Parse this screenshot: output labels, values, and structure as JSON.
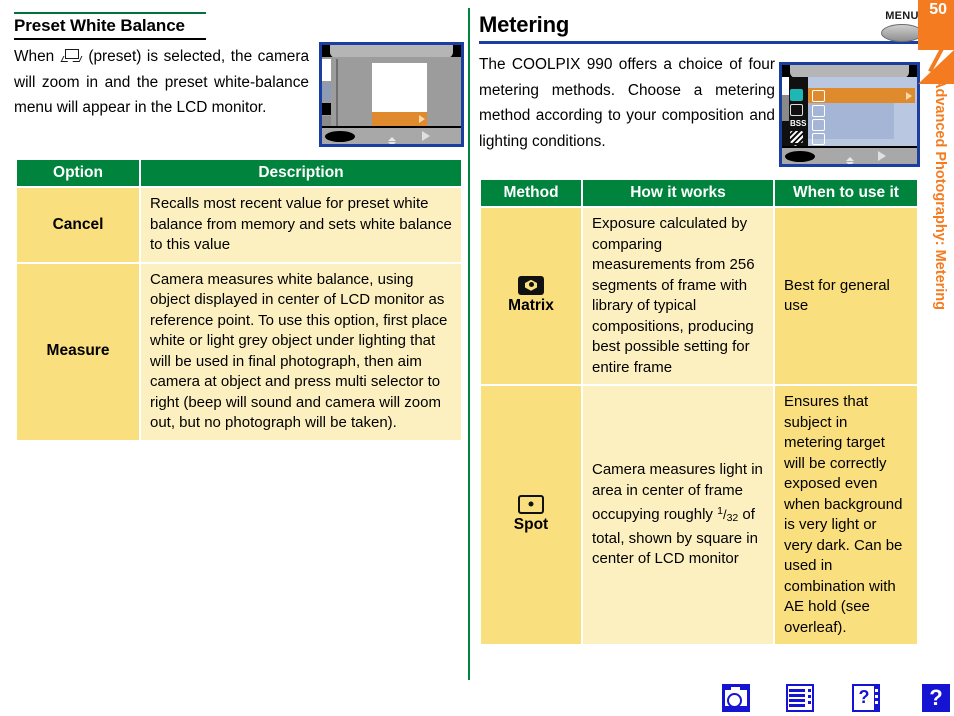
{
  "page": {
    "number": "50",
    "side_tab_text": "Advanced Photography: Metering"
  },
  "left": {
    "heading": "Preset White Balance",
    "intro_before_icon": "When",
    "intro_icon": "preset-white-balance-icon",
    "intro_after_icon": "(preset) is selected, the camera will zoom in and the preset white-balance menu will appear in the LCD monitor.",
    "table": {
      "headers": [
        "Option",
        "Description"
      ],
      "rows": [
        {
          "option": "Cancel",
          "description": "Recalls most recent value for preset white balance from memory and sets white balance to this value"
        },
        {
          "option": "Measure",
          "description": "Camera measures white balance, using object displayed in center of LCD monitor as reference point. To use this option, first place white or light grey object under lighting that will be used in final photograph, then aim camera at object and press multi selector to right (beep will sound and camera will zoom out, but no photograph will be taken)."
        }
      ]
    }
  },
  "right": {
    "heading": "Metering",
    "intro": "The COOLPIX 990 offers a choice of four metering methods.  Choose a metering method according to your composition and lighting conditions.",
    "menu_button_label": "MENU",
    "table": {
      "headers": [
        "Method",
        "How it works",
        "When to use it"
      ],
      "rows": [
        {
          "method_label": "Matrix",
          "method_icon": "matrix-metering-icon",
          "how_it_works": "Exposure calculated by comparing measurements from 256 segments of frame with library of typical compositions, producing best possible setting for entire frame",
          "when_to_use": "Best for general use"
        },
        {
          "method_label": "Spot",
          "method_icon": "spot-metering-icon",
          "how_it_works_part1": "Camera measures light in area in center of frame occupying roughly",
          "how_it_works_fraction_num": "1",
          "how_it_works_fraction_den": "32",
          "how_it_works_part2": "of total, shown by square in center of LCD monitor",
          "when_to_use": "Ensures that subject in metering target will be correctly exposed even when background is very light or very dark.  Can be used in combination with AE hold (see overleaf)."
        }
      ]
    }
  },
  "bottom_nav": [
    {
      "name": "camera-icon",
      "label": ""
    },
    {
      "name": "menu-list-icon",
      "label": ""
    },
    {
      "name": "help-page-icon",
      "label": "?"
    },
    {
      "name": "question-mark-icon",
      "label": "?"
    }
  ],
  "colors": {
    "table_header_green": "#00843d",
    "cell_yellow": "#fadf7f",
    "cell_cream": "#fdf0c0",
    "rule_blue": "#1b3fa0",
    "accent_orange": "#f47b20",
    "nav_blue": "#1414d2",
    "divider_green": "#00843d"
  }
}
